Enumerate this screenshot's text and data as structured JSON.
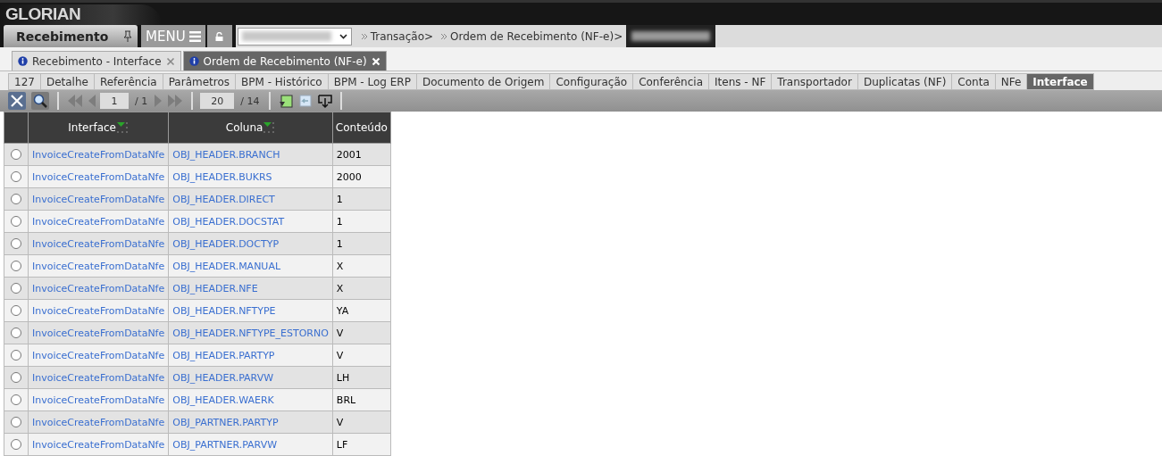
{
  "brand": "GLORIAN",
  "module": {
    "title": "Recebimento",
    "menu_label": "MENU"
  },
  "breadcrumb": [
    "Transação>",
    "Ordem de Recebimento (NF-e)>"
  ],
  "doc_tabs": [
    {
      "label": "Recebimento - Interface",
      "selected": false
    },
    {
      "label": "Ordem de Recebimento (NF-e)",
      "selected": true
    }
  ],
  "tabs": [
    {
      "label": "127",
      "selected": false
    },
    {
      "label": "Detalhe",
      "selected": false
    },
    {
      "label": "Referência",
      "selected": false
    },
    {
      "label": "Parâmetros",
      "selected": false
    },
    {
      "label": "BPM - Histórico",
      "selected": false
    },
    {
      "label": "BPM - Log ERP",
      "selected": false
    },
    {
      "label": "Documento de Origem",
      "selected": false
    },
    {
      "label": "Configuração",
      "selected": false
    },
    {
      "label": "Conferência",
      "selected": false
    },
    {
      "label": "Itens - NF",
      "selected": false
    },
    {
      "label": "Transportador",
      "selected": false
    },
    {
      "label": "Duplicatas (NF)",
      "selected": false
    },
    {
      "label": "Conta",
      "selected": false
    },
    {
      "label": "NFe",
      "selected": false
    },
    {
      "label": "Interface",
      "selected": true
    }
  ],
  "pager": {
    "page": "1",
    "pages": "/ 1",
    "page_size": "20",
    "total": "/ 14"
  },
  "table": {
    "columns": [
      "Interface",
      "Coluna",
      "Conteúdo"
    ],
    "rows": [
      {
        "interface": "InvoiceCreateFromDataNfe",
        "coluna": "OBJ_HEADER.BRANCH",
        "conteudo": "2001",
        "selected": false
      },
      {
        "interface": "InvoiceCreateFromDataNfe",
        "coluna": "OBJ_HEADER.BUKRS",
        "conteudo": "2000",
        "selected": false
      },
      {
        "interface": "InvoiceCreateFromDataNfe",
        "coluna": "OBJ_HEADER.DIRECT",
        "conteudo": "1",
        "selected": false
      },
      {
        "interface": "InvoiceCreateFromDataNfe",
        "coluna": "OBJ_HEADER.DOCSTAT",
        "conteudo": "1",
        "selected": false
      },
      {
        "interface": "InvoiceCreateFromDataNfe",
        "coluna": "OBJ_HEADER.DOCTYP",
        "conteudo": "1",
        "selected": false
      },
      {
        "interface": "InvoiceCreateFromDataNfe",
        "coluna": "OBJ_HEADER.MANUAL",
        "conteudo": "X",
        "selected": false
      },
      {
        "interface": "InvoiceCreateFromDataNfe",
        "coluna": "OBJ_HEADER.NFE",
        "conteudo": "X",
        "selected": false
      },
      {
        "interface": "InvoiceCreateFromDataNfe",
        "coluna": "OBJ_HEADER.NFTYPE",
        "conteudo": "YA",
        "selected": false
      },
      {
        "interface": "InvoiceCreateFromDataNfe",
        "coluna": "OBJ_HEADER.NFTYPE_ESTORNO",
        "conteudo": "V",
        "selected": false
      },
      {
        "interface": "InvoiceCreateFromDataNfe",
        "coluna": "OBJ_HEADER.PARTYP",
        "conteudo": "V",
        "selected": false
      },
      {
        "interface": "InvoiceCreateFromDataNfe",
        "coluna": "OBJ_HEADER.PARVW",
        "conteudo": "LH",
        "selected": false
      },
      {
        "interface": "InvoiceCreateFromDataNfe",
        "coluna": "OBJ_HEADER.WAERK",
        "conteudo": "BRL",
        "selected": false
      },
      {
        "interface": "InvoiceCreateFromDataNfe",
        "coluna": "OBJ_PARTNER.PARTYP",
        "conteudo": "V",
        "selected": false
      },
      {
        "interface": "InvoiceCreateFromDataNfe",
        "coluna": "OBJ_PARTNER.PARVW",
        "conteudo": "LF",
        "selected": false
      }
    ]
  }
}
